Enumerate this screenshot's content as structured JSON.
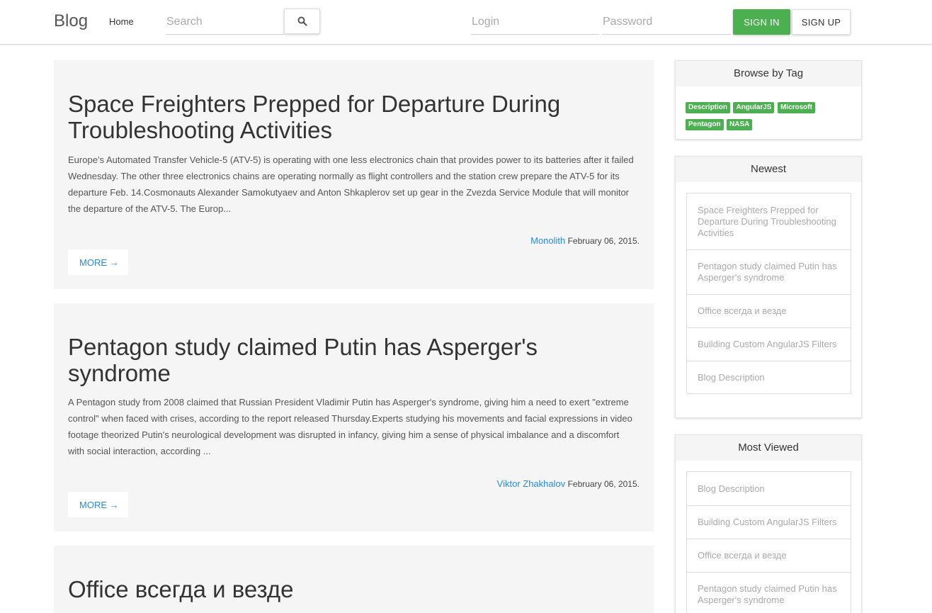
{
  "navbar": {
    "brand": "Blog",
    "home_label": "Home",
    "search_placeholder": "Search",
    "search_icon": "search-icon",
    "login_placeholder": "Login",
    "password_placeholder": "Password",
    "signin_label": "SIGN IN",
    "signup_label": "SIGN UP"
  },
  "posts": [
    {
      "title": "Space Freighters Prepped for Departure During Troubleshooting Activities",
      "excerpt": "Europe’s Automated Transfer Vehicle-5 (ATV-5) is operating with one less electronics chain that provides power to its batteries after it failed Wednesday. The other three electronics chains are operating normally as flight controllers and the station crew prepare the ATV-5 for its departure Feb. 14.Cosmonauts Alexander Samokutyaev and Anton Shkaplerov set up gear in the Zvezda Service Module that will monitor the departure of the ATV-5. The Europ...",
      "author": "Monolith",
      "date": "February 06, 2015.",
      "more_label": "MORE →"
    },
    {
      "title": "Pentagon study claimed Putin has Asperger's syndrome",
      "excerpt": "A Pentagon study from 2008 claimed that Russian President Vladimir Putin has Asperger's syndrome, giving him a need to exert \"extreme control\" when faced with crises, according to the report released Thursday.Experts studying his movements and facial expressions in video footage theorized Putin's neurological development was disrupted in infancy, giving him a sense of physical imbalance and a discomfort with social interaction, according ...",
      "author": "Viktor Zhakhalov",
      "date": "February 06, 2015.",
      "more_label": "MORE →"
    },
    {
      "title": "Office всегда и везде"
    }
  ],
  "sidebar": {
    "tags_panel": {
      "title": "Browse by Tag",
      "tags": [
        "Description",
        "AngularJS",
        "Microsoft",
        "Pentagon",
        "NASA"
      ]
    },
    "newest_panel": {
      "title": "Newest",
      "items": [
        "Space Freighters Prepped for Departure During Troubleshooting Activities",
        "Pentagon study claimed Putin has Asperger's syndrome",
        "Office всегда и везде",
        "Building Custom AngularJS Filters",
        "Blog Description"
      ]
    },
    "most_viewed_panel": {
      "title": "Most Viewed",
      "items": [
        "Blog Description",
        "Building Custom AngularJS Filters",
        "Office всегда и везде",
        "Pentagon study claimed Putin has Asperger's syndrome"
      ]
    }
  },
  "colors": {
    "accent_green": "#4caf50",
    "link_blue": "#2a8adf",
    "post_bg": "#f5f5f5"
  }
}
